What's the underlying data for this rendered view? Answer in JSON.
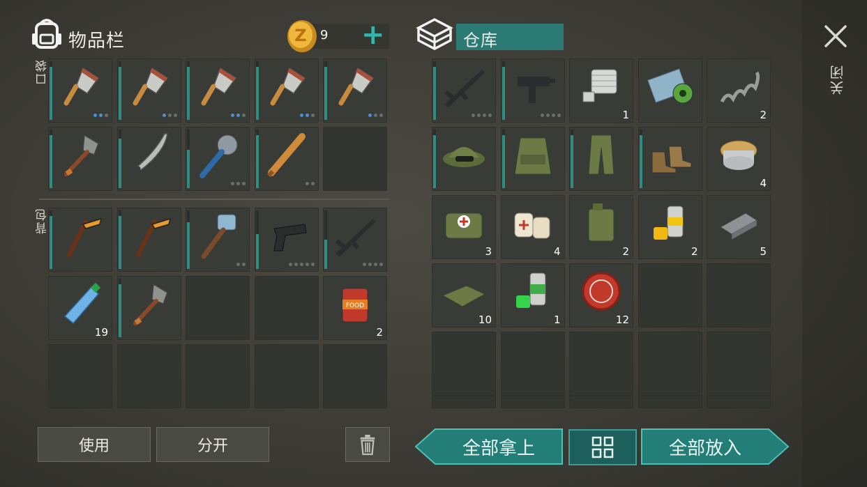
{
  "header": {
    "inventory_title": "物品栏",
    "coins": "9",
    "add_symbol": "+",
    "storage_title": "仓库",
    "close_label": "关闭"
  },
  "side_labels": {
    "pocket": "口袋",
    "backpack": "背包"
  },
  "colors": {
    "accent": "#2f8c83",
    "button_teal": "#237e78",
    "dot_blue": "#4a8fd6"
  },
  "pocket_slots": [
    {
      "item": "cleaver",
      "durability": 0.9,
      "dots": [
        1,
        1,
        0
      ]
    },
    {
      "item": "cleaver",
      "durability": 0.9,
      "dots": [
        1,
        0,
        0
      ]
    },
    {
      "item": "cleaver",
      "durability": 0.9,
      "dots": [
        1,
        1,
        0
      ]
    },
    {
      "item": "cleaver",
      "durability": 0.9,
      "dots": [
        1,
        1,
        0
      ]
    },
    {
      "item": "cleaver",
      "durability": 0.9,
      "dots": [
        1,
        0,
        0
      ]
    },
    {
      "item": "shovel",
      "durability": 0.9
    },
    {
      "item": "machete",
      "durability": 0.85
    },
    {
      "item": "spiked-club",
      "durability": 0.65,
      "dots": [
        0,
        0,
        0
      ]
    },
    {
      "item": "baseball-bat",
      "durability": 0.9,
      "dots": [
        0,
        0
      ]
    },
    {
      "item": "empty"
    }
  ],
  "backpack_slots": [
    {
      "item": "hockey-stick",
      "durability": 0.9
    },
    {
      "item": "hockey-stick",
      "durability": 0.9
    },
    {
      "item": "sledgehammer",
      "durability": 0.8,
      "dots": [
        0,
        0
      ]
    },
    {
      "item": "pistol",
      "durability": 0.6,
      "dots": [
        0,
        0,
        0,
        0,
        0
      ]
    },
    {
      "item": "assault-rifle",
      "durability": 0.5,
      "dots": [
        0,
        0,
        0,
        0
      ]
    },
    {
      "item": "water-bottle",
      "count": "19"
    },
    {
      "item": "shovel",
      "durability": 0.9
    },
    {
      "item": "empty"
    },
    {
      "item": "empty"
    },
    {
      "item": "canned-food",
      "count": "2"
    },
    {
      "item": "empty"
    },
    {
      "item": "empty"
    },
    {
      "item": "empty"
    },
    {
      "item": "empty"
    },
    {
      "item": "empty"
    }
  ],
  "storage_slots": [
    {
      "item": "assault-rifle",
      "durability": 0.9,
      "dots": [
        0,
        0,
        0,
        0
      ]
    },
    {
      "item": "uzi",
      "durability": 0.9,
      "dots": [
        0,
        0,
        0,
        0
      ]
    },
    {
      "item": "engine-cylinder",
      "count": "1"
    },
    {
      "item": "biohazard-blueprint"
    },
    {
      "item": "spring",
      "count": "2"
    },
    {
      "item": "camo-hat",
      "durability": 0.9
    },
    {
      "item": "camo-vest",
      "durability": 0.9
    },
    {
      "item": "camo-pants",
      "durability": 0.9
    },
    {
      "item": "boots",
      "durability": 0.9
    },
    {
      "item": "wire-spool",
      "count": "4"
    },
    {
      "item": "medkit",
      "count": "3"
    },
    {
      "item": "bandages",
      "count": "4"
    },
    {
      "item": "jerry-can",
      "count": "2"
    },
    {
      "item": "yellow-paint",
      "count": "2"
    },
    {
      "item": "metal-bar",
      "count": "5"
    },
    {
      "item": "cloth",
      "count": "10"
    },
    {
      "item": "green-paint",
      "count": "1"
    },
    {
      "item": "bottle-cap",
      "count": "12"
    },
    {
      "item": "empty"
    },
    {
      "item": "empty"
    },
    {
      "item": "empty"
    },
    {
      "item": "empty"
    },
    {
      "item": "empty"
    },
    {
      "item": "empty"
    },
    {
      "item": "empty"
    }
  ],
  "buttons": {
    "use": "使用",
    "split": "分开",
    "take_all": "全部拿上",
    "put_all": "全部放入"
  }
}
